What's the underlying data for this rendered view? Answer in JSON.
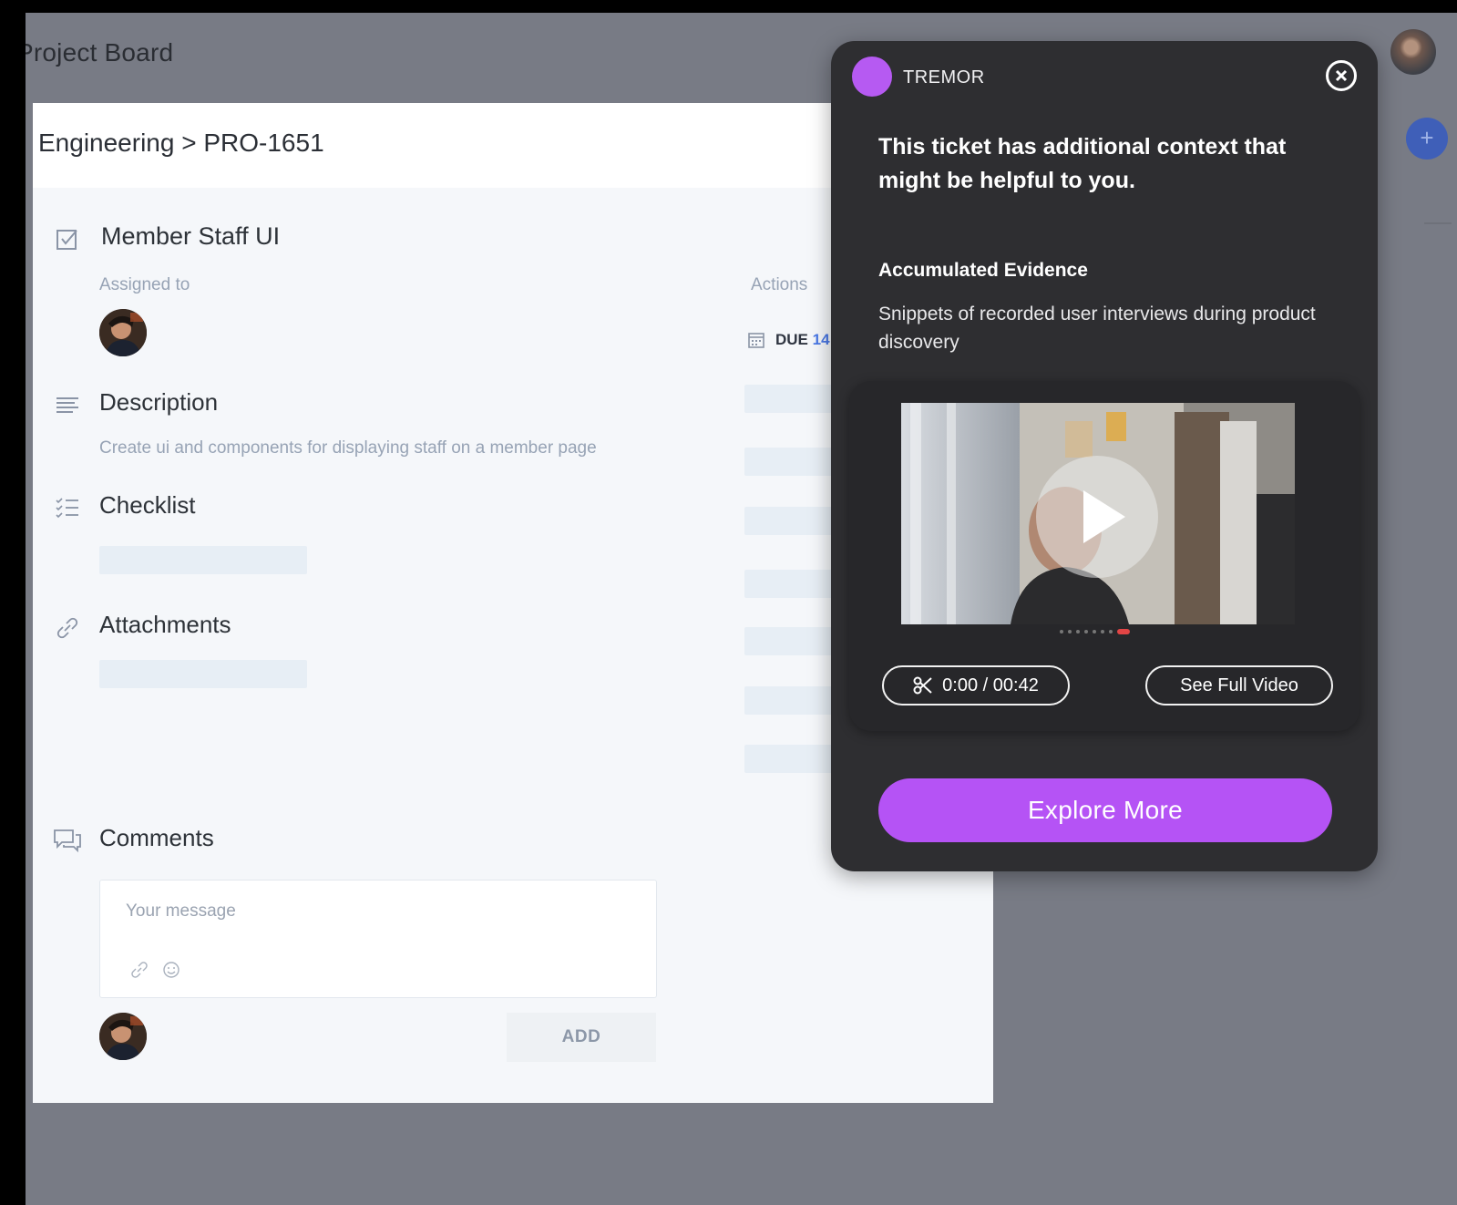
{
  "board": {
    "title": "Project Board"
  },
  "ticket": {
    "breadcrumb": "Engineering > PRO-1651",
    "title": "Member Staff UI",
    "assigned_label": "Assigned to",
    "actions_label": "Actions",
    "due_label": "DUE",
    "due_value": "14",
    "description_title": "Description",
    "description_text": "Create ui and components for displaying staff on a member page",
    "checklist_title": "Checklist",
    "attachments_title": "Attachments",
    "comments_title": "Comments",
    "comment_placeholder": "Your message",
    "add_label": "ADD"
  },
  "tremor": {
    "brand": "TREMOR",
    "headline": "This ticket has additional context that might be helpful to you.",
    "section_title": "Accumulated Evidence",
    "section_desc": "Snippets of recorded user interviews during product discovery",
    "clip_time": "0:00 / 00:42",
    "full_video_label": "See Full Video",
    "explore_label": "Explore More",
    "accent": "#b553f5"
  }
}
